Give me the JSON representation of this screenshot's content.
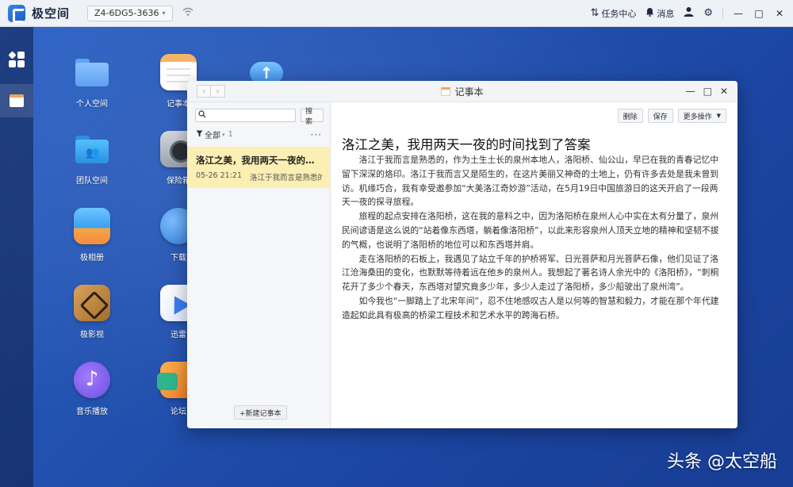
{
  "topbar": {
    "app_name": "极空间",
    "device": "Z4-6DG5-3636",
    "task_center": "任务中心",
    "messages": "消息"
  },
  "desktop": {
    "apps": [
      {
        "label": "个人空间",
        "icon": "folder-icon"
      },
      {
        "label": "记事本",
        "icon": "notepad-icon"
      },
      {
        "label": "团队空间",
        "icon": "team-folder-icon"
      },
      {
        "label": "保险箱",
        "icon": "safe-icon"
      },
      {
        "label": "极相册",
        "icon": "photo-icon"
      },
      {
        "label": "下载",
        "icon": "globe-icon"
      },
      {
        "label": "极影视",
        "icon": "video-icon"
      },
      {
        "label": "迅雷",
        "icon": "thunder-icon"
      },
      {
        "label": "音乐播放",
        "icon": "music-icon"
      },
      {
        "label": "论坛",
        "icon": "chat-icon"
      }
    ]
  },
  "window": {
    "title": "记事本",
    "sidebar": {
      "search_placeholder": "",
      "search_button": "搜索",
      "filter_label": "全部",
      "filter_count": "1",
      "new_note": "+新建记事本",
      "notes": [
        {
          "title": "洛江之美，我用两天一夜的时间找到了答案",
          "date": "05-26 21:21",
          "preview": "洛江于我而言是熟悉的，作为土生土长的泉州本地人"
        }
      ]
    },
    "toolbar": {
      "delete": "删除",
      "save": "保存",
      "more": "更多操作"
    },
    "document": {
      "title": "洛江之美，我用两天一夜的时间找到了答案",
      "paragraphs": [
        "洛江于我而言是熟悉的，作为土生土长的泉州本地人，洛阳桥、仙公山，早已在我的青春记忆中留下深深的烙印。洛江于我而言又是陌生的，在这片美丽又神奇的土地上，仍有许多去处是我未曾到访。机缘巧合，我有幸受邀参加“大美洛江奇妙游”活动，在5月19日中国旅游日的这天开启了一段两天一夜的探寻旅程。",
        "旅程的起点安排在洛阳桥，这在我的意料之中，因为洛阳桥在泉州人心中实在太有分量了，泉州民间谚语是这么说的“站着像东西塔，躺着像洛阳桥”，以此来形容泉州人顶天立地的精神和坚韧不拔的气概，也说明了洛阳桥的地位可以和东西塔并肩。",
        "走在洛阳桥的石板上，我遇见了站立千年的护桥将军、日光菩萨和月光菩萨石像，他们见证了洛江沧海桑田的变化，也默默等待着远在他乡的泉州人。我想起了著名诗人余光中的《洛阳桥》，“刺桐花开了多少个春天，东西塔对望究竟多少年，多少人走过了洛阳桥，多少船驶出了泉州湾”。",
        "如今我也“一脚踏上了北宋年间”，忍不住地感叹古人是以何等的智慧和毅力，才能在那个年代建造起如此具有极高的桥梁工程技术和艺术水平的跨海石桥。"
      ]
    }
  },
  "watermark": "头条 @太空船"
}
